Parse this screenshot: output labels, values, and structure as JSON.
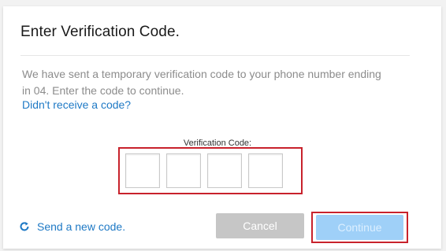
{
  "dialog": {
    "title": "Enter Verification Code.",
    "message": "We have sent a temporary verification code to your phone number ending in 04. Enter the code to continue.",
    "resend_link": "Didn't receive a code?",
    "code_label": "Verification Code:",
    "code_digits": [
      "",
      "",
      "",
      ""
    ],
    "send_new_label": "Send a new code.",
    "send_new_icon": "refresh-icon",
    "cancel_label": "Cancel",
    "continue_label": "Continue",
    "colors": {
      "link": "#1e79c5",
      "highlight": "#c8222c",
      "cancel_bg": "#c6c6c6",
      "continue_bg": "#9fd0f8"
    }
  }
}
